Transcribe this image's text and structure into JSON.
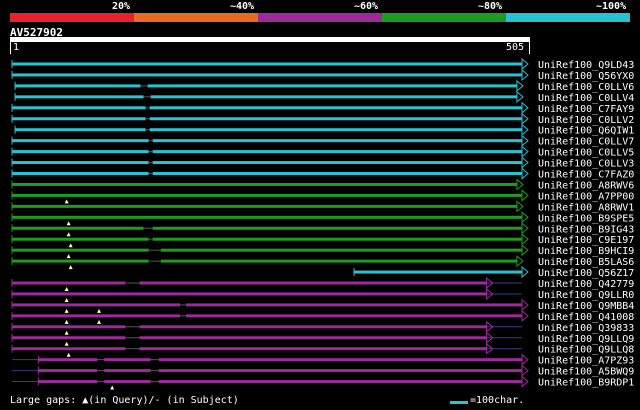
{
  "legend": {
    "labels": [
      "20%",
      "~40%",
      "~60%",
      "~80%",
      "~100%"
    ],
    "colors": [
      "#e8212d",
      "#e86c1f",
      "#9c2a9a",
      "#1f9c1f",
      "#27c3d2"
    ]
  },
  "query": {
    "id": "AV527902",
    "start_label": "1",
    "end_label": "505",
    "length": 505
  },
  "hits": [
    {
      "label": "UniRef100_Q9LD43",
      "color": "cyan",
      "start": 1,
      "end": 505,
      "gaps": []
    },
    {
      "label": "UniRef100_Q56YX0",
      "color": "cyan",
      "start": 1,
      "end": 505,
      "gaps": []
    },
    {
      "label": "UniRef100_C0LLV6",
      "color": "cyan",
      "start": 4,
      "end": 500,
      "gaps": [
        [
          128,
          135
        ]
      ]
    },
    {
      "label": "UniRef100_C0LLV4",
      "color": "cyan",
      "start": 4,
      "end": 500,
      "gaps": [
        [
          131,
          138
        ]
      ]
    },
    {
      "label": "UniRef100_C7FAY9",
      "color": "cyan",
      "start": 1,
      "end": 505,
      "gaps": [
        [
          133,
          137
        ]
      ]
    },
    {
      "label": "UniRef100_C0LLV2",
      "color": "cyan",
      "start": 1,
      "end": 505,
      "gaps": [
        [
          133,
          137
        ]
      ]
    },
    {
      "label": "UniRef100_Q6QIW1",
      "color": "cyan",
      "start": 4,
      "end": 505,
      "gaps": [
        [
          133,
          137
        ]
      ]
    },
    {
      "label": "UniRef100_C0LLV7",
      "color": "cyan",
      "start": 1,
      "end": 505,
      "gaps": [
        [
          136,
          140
        ]
      ]
    },
    {
      "label": "UniRef100_C0LLV5",
      "color": "cyan",
      "start": 1,
      "end": 505,
      "gaps": [
        [
          136,
          140
        ]
      ]
    },
    {
      "label": "UniRef100_C0LLV3",
      "color": "cyan",
      "start": 1,
      "end": 505,
      "gaps": [
        [
          136,
          140
        ]
      ]
    },
    {
      "label": "UniRef100_C7FAZ0",
      "color": "cyan",
      "start": 1,
      "end": 505,
      "gaps": [
        [
          136,
          140
        ]
      ]
    },
    {
      "label": "UniRef100_A8RWV6",
      "color": "green",
      "start": 1,
      "end": 500,
      "gaps": []
    },
    {
      "label": "UniRef100_A7PP00",
      "color": "green",
      "start": 1,
      "end": 505,
      "gaps": [],
      "insertions": [
        55
      ]
    },
    {
      "label": "UniRef100_A8RWV1",
      "color": "green",
      "start": 1,
      "end": 500,
      "gaps": []
    },
    {
      "label": "UniRef100_B9SPE5",
      "color": "green",
      "start": 1,
      "end": 505,
      "gaps": [],
      "insertions": [
        57
      ]
    },
    {
      "label": "UniRef100_B9IG43",
      "color": "green",
      "start": 1,
      "end": 505,
      "gaps": [
        [
          131,
          140
        ]
      ],
      "insertions": [
        57
      ]
    },
    {
      "label": "UniRef100_C9E197",
      "color": "green",
      "start": 1,
      "end": 505,
      "gaps": [
        [
          136,
          140
        ]
      ],
      "insertions": [
        59
      ]
    },
    {
      "label": "UniRef100_B9HCI9",
      "color": "green",
      "start": 1,
      "end": 505,
      "gaps": [
        [
          136,
          148
        ]
      ],
      "insertions": [
        57
      ]
    },
    {
      "label": "UniRef100_B5LAS6",
      "color": "green",
      "start": 1,
      "end": 500,
      "gaps": [
        [
          136,
          148
        ]
      ],
      "insertions": [
        59
      ]
    },
    {
      "label": "UniRef100_Q56Z17",
      "color": "cyan",
      "start": 339,
      "end": 505,
      "gaps": []
    },
    {
      "label": "UniRef100_Q42779",
      "color": "purple",
      "start": 1,
      "end": 470,
      "gaps": [
        [
          113,
          127
        ]
      ],
      "insertions": [
        55
      ],
      "tail_end": 505
    },
    {
      "label": "UniRef100_Q9LLR0",
      "color": "purple",
      "start": 1,
      "end": 470,
      "gaps": [],
      "insertions": [
        55
      ],
      "tail_end": 505
    },
    {
      "label": "UniRef100_Q9MBB4",
      "color": "purple",
      "start": 1,
      "end": 505,
      "gaps": [
        [
          167,
          173
        ]
      ],
      "insertions": [
        55,
        87
      ],
      "lead_start": 1
    },
    {
      "label": "UniRef100_Q41008",
      "color": "purple",
      "start": 1,
      "end": 505,
      "gaps": [
        [
          167,
          173
        ]
      ],
      "insertions": [
        55,
        87
      ],
      "lead_start": 1
    },
    {
      "label": "UniRef100_Q39833",
      "color": "purple",
      "start": 1,
      "end": 470,
      "gaps": [
        [
          113,
          127
        ]
      ],
      "insertions": [
        55
      ],
      "tail_end": 505
    },
    {
      "label": "UniRef100_Q9LLQ9",
      "color": "purple",
      "start": 1,
      "end": 470,
      "gaps": [
        [
          113,
          127
        ]
      ],
      "insertions": [
        55
      ],
      "tail_end": 505
    },
    {
      "label": "UniRef100_Q9LLQ8",
      "color": "purple",
      "start": 1,
      "end": 470,
      "gaps": [
        [
          113,
          127
        ]
      ],
      "insertions": [
        57
      ],
      "tail_end": 505
    },
    {
      "label": "UniRef100_A7PZ93",
      "color": "purple",
      "start": 27,
      "end": 505,
      "gaps": [
        [
          85,
          92
        ],
        [
          138,
          146
        ]
      ],
      "lead_start": 1
    },
    {
      "label": "UniRef100_A5BWQ9",
      "color": "purple",
      "start": 27,
      "end": 505,
      "gaps": [
        [
          85,
          92
        ],
        [
          138,
          146
        ]
      ],
      "lead_start": 1
    },
    {
      "label": "UniRef100_B9RDP1",
      "color": "purple",
      "start": 27,
      "end": 505,
      "gaps": [
        [
          85,
          92
        ],
        [
          138,
          146
        ]
      ],
      "insertions": [
        100
      ],
      "lead_start": 1
    }
  ],
  "footer": {
    "gaps_prefix": "Large gaps: ",
    "gaps_suffix": "(in Query)/- (in Subject)",
    "scale_label": "=100char."
  }
}
